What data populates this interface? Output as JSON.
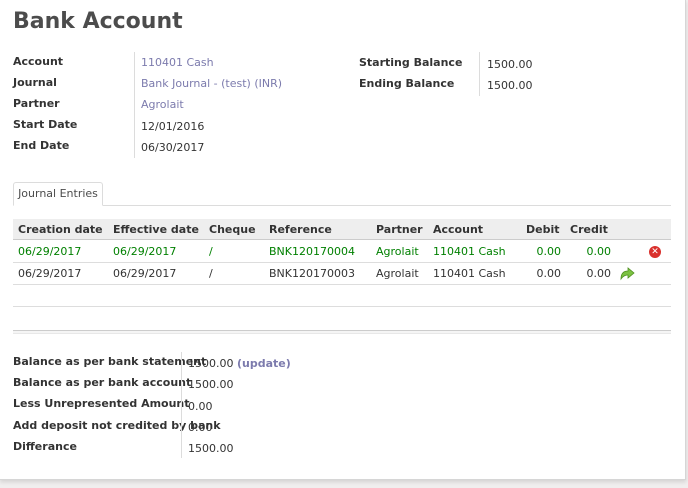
{
  "title": "Bank Account",
  "info_left": [
    {
      "label": "Account",
      "value": "110401 Cash",
      "link": true
    },
    {
      "label": "Journal",
      "value": "Bank Journal - (test) (INR)",
      "link": true
    },
    {
      "label": "Partner",
      "value": "Agrolait",
      "link": true
    },
    {
      "label": "Start Date",
      "value": "12/01/2016",
      "link": false
    },
    {
      "label": "End Date",
      "value": "06/30/2017",
      "link": false
    }
  ],
  "info_right": [
    {
      "label": "Starting Balance",
      "value": "1500.00"
    },
    {
      "label": "Ending Balance",
      "value": "1500.00"
    }
  ],
  "tab_label": "Journal Entries",
  "columns": [
    "Creation date",
    "Effective date",
    "Cheque",
    "Reference",
    "Partner",
    "Account",
    "Debit",
    "Credit"
  ],
  "rows": [
    {
      "creation_date": "06/29/2017",
      "effective_date": "06/29/2017",
      "cheque": "/",
      "reference": "BNK120170004",
      "partner": "Agrolait",
      "account": "110401 Cash",
      "debit": "0.00",
      "credit": "0.00",
      "icon": "remove-icon",
      "reconciled": true
    },
    {
      "creation_date": "06/29/2017",
      "effective_date": "06/29/2017",
      "cheque": "/",
      "reference": "BNK120170003",
      "partner": "Agrolait",
      "account": "110401 Cash",
      "debit": "0.00",
      "credit": "0.00",
      "icon": "reconcile-arrow-icon",
      "reconciled": false
    }
  ],
  "summary": [
    {
      "label": "Balance as per bank statement",
      "value": "1500.00",
      "action": "(update)"
    },
    {
      "label": "Balance as per bank account",
      "value": "1500.00"
    },
    {
      "label": "Less Unrepresented Amount",
      "value": "0.00"
    },
    {
      "label": "Add deposit not credited by bank",
      "value": "0.00"
    },
    {
      "label": "Differance",
      "value": "1500.00"
    }
  ],
  "colors": {
    "link": "#7c7bad",
    "reconciled_row": "#008000",
    "remove_icon": "#d9302c",
    "reconcile_icon": "#7cc242"
  }
}
